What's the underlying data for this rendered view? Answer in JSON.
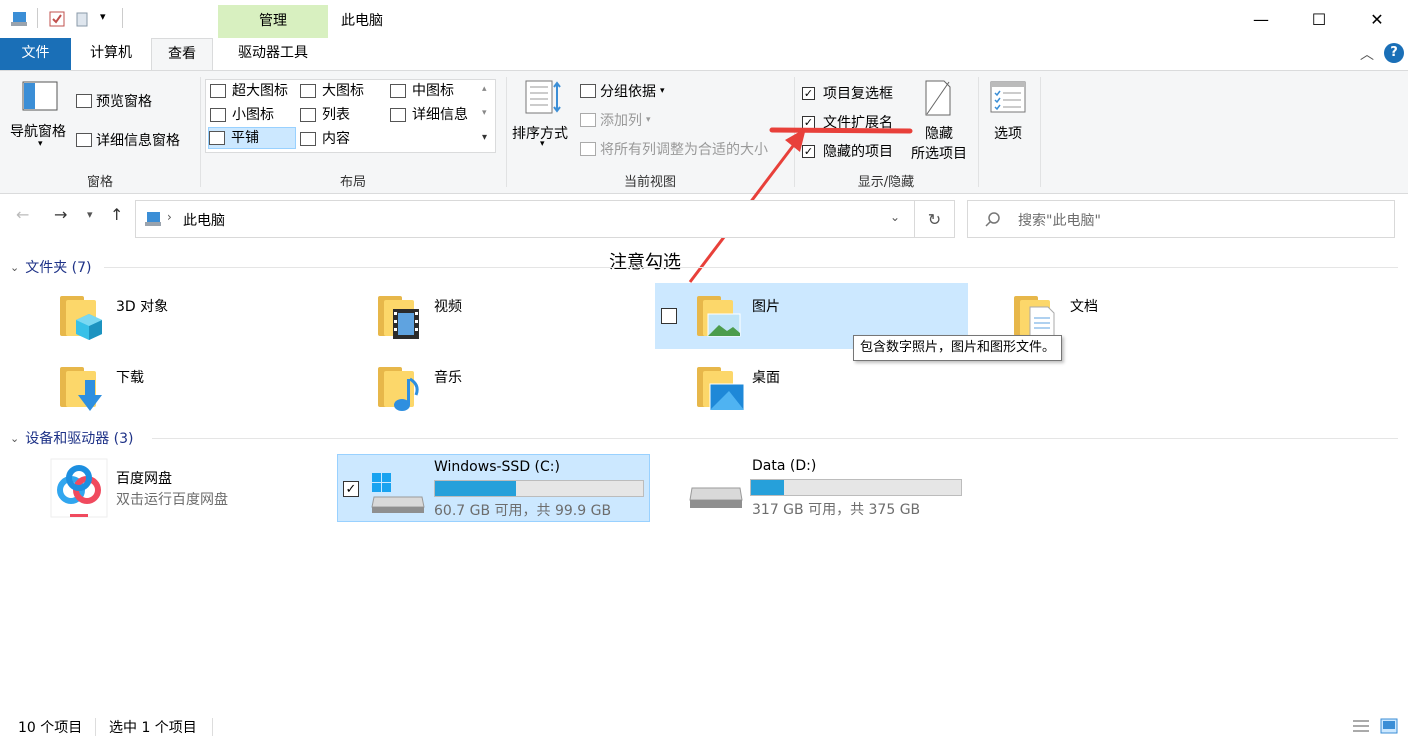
{
  "window": {
    "title": "此电脑",
    "context_tab_header": "管理",
    "minimize": "—",
    "maximize": "☐",
    "close": "✕"
  },
  "tabs": {
    "file": "文件",
    "computer": "计算机",
    "view": "查看",
    "drive_tools": "驱动器工具"
  },
  "ribbon": {
    "panes": {
      "nav_pane": "导航窗格",
      "preview_pane": "预览窗格",
      "details_pane": "详细信息窗格",
      "group_label": "窗格"
    },
    "layout": {
      "items": [
        "超大图标",
        "大图标",
        "中图标",
        "小图标",
        "列表",
        "详细信息",
        "平铺",
        "内容"
      ],
      "selected": "平铺",
      "group_label": "布局"
    },
    "current_view": {
      "sort_by": "排序方式",
      "group_by": "分组依据",
      "add_column": "添加列",
      "fit_columns": "将所有列调整为合适的大小",
      "group_label": "当前视图"
    },
    "show_hide": {
      "item_checkboxes": "项目复选框",
      "file_extensions": "文件扩展名",
      "hidden_items": "隐藏的项目",
      "hide_selected_line1": "隐藏",
      "hide_selected_line2": "所选项目",
      "group_label": "显示/隐藏"
    },
    "options": "选项"
  },
  "address": {
    "path": "此电脑",
    "search_placeholder": "搜索\"此电脑\""
  },
  "annotation": "注意勾选",
  "folders_section": {
    "header": "文件夹 (7)",
    "items": [
      "3D 对象",
      "视频",
      "图片",
      "文档",
      "下载",
      "音乐",
      "桌面"
    ]
  },
  "tooltip": "包含数字照片，图片和图形文件。",
  "devices_section": {
    "header": "设备和驱动器 (3)",
    "baidu": {
      "name": "百度网盘",
      "desc": "双击运行百度网盘"
    },
    "drive_c": {
      "name": "Windows-SSD (C:)",
      "space": "60.7 GB 可用，共 99.9 GB",
      "used_fraction": 0.39
    },
    "drive_d": {
      "name": "Data (D:)",
      "space": "317 GB 可用，共 375 GB",
      "used_fraction": 0.155
    }
  },
  "status": {
    "count": "10 个项目",
    "selected": "选中 1 个项目"
  },
  "colors": {
    "accent": "#1a6fb7",
    "selection": "#cce8ff",
    "drive_fill": "#26a0da",
    "arrow": "#e8403a"
  }
}
